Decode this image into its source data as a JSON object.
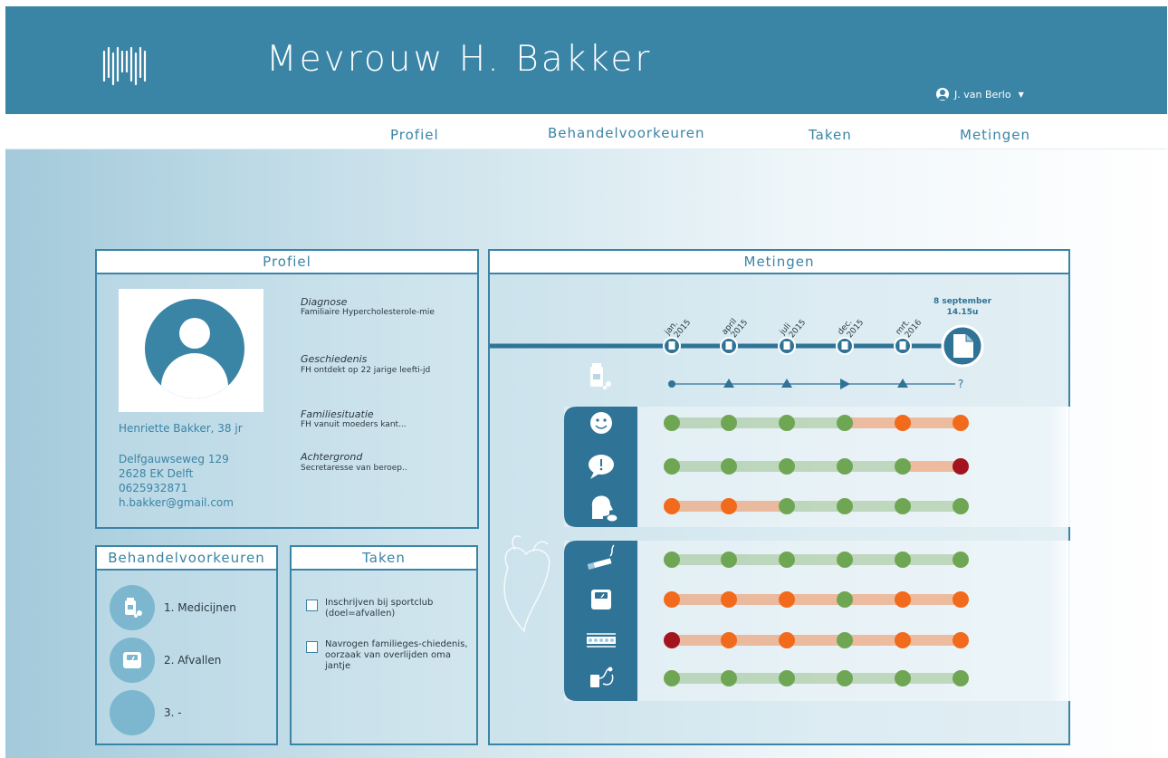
{
  "header": {
    "patient_name": "Mevrouw H. Bakker",
    "user_name": "J. van Berlo",
    "user_caret": "▼",
    "brand_color": "#3a84a6"
  },
  "nav": {
    "tabs": [
      {
        "label": "Profiel"
      },
      {
        "label": "Behandelvoorkeuren"
      },
      {
        "label": "Taken"
      },
      {
        "label": "Metingen"
      }
    ]
  },
  "profiel": {
    "title": "Profiel",
    "name_age": "Henriette Bakker, 38 jr",
    "address_line1": "Delfgauwseweg 129",
    "address_line2": "2628 EK Delft",
    "phone": "0625932871",
    "email": "h.bakker@gmail.com",
    "diagnose_label": "Diagnose",
    "diagnose_value": "Familiaire Hypercholesterole-mie",
    "geschiedenis_label": "Geschiedenis",
    "geschiedenis_value": "FH ontdekt op 22 jarige leefti-jd",
    "familie_label": "Familiesituatie",
    "familie_value": "FH vanuit moeders kant...",
    "achtergrond_label": "Achtergrond",
    "achtergrond_value": "Secretaresse van beroep.."
  },
  "behandelvoorkeuren": {
    "title": "Behandelvoorkeuren",
    "items": [
      {
        "label": "1. Medicijnen",
        "icon": "medication-icon"
      },
      {
        "label": "2. Afvallen",
        "icon": "scale-icon"
      },
      {
        "label": "3. -",
        "icon": "empty-icon"
      }
    ]
  },
  "taken": {
    "title": "Taken",
    "items": [
      {
        "label": "Inschrijven bij sportclub (doel=afvallen)",
        "checked": false
      },
      {
        "label": "Navrogen familieges-chiedenis, oorzaak van overlijden oma jantje",
        "checked": false
      }
    ]
  },
  "metingen": {
    "title": "Metingen",
    "dates": [
      "jan. 2015",
      "april 2015",
      "juli 2015",
      "dec. 2015",
      "mrt. 2016"
    ],
    "current_date": "8 september",
    "current_time": "14.15u",
    "medication_trend": [
      "dot",
      "up",
      "up",
      "right",
      "up",
      "?"
    ],
    "status_colors": {
      "green": "#6fa654",
      "orange": "#f26a1b",
      "red": "#a3141e"
    },
    "groups": [
      {
        "rows": [
          {
            "icon": "mood-icon",
            "statuses": [
              "green",
              "green",
              "green",
              "green",
              "orange",
              "orange"
            ]
          },
          {
            "icon": "alert-icon",
            "statuses": [
              "green",
              "green",
              "green",
              "green",
              "green",
              "red"
            ]
          },
          {
            "icon": "head-icon",
            "statuses": [
              "orange",
              "orange",
              "green",
              "green",
              "green",
              "green"
            ]
          }
        ]
      },
      {
        "rows": [
          {
            "icon": "cigarette-icon",
            "statuses": [
              "green",
              "green",
              "green",
              "green",
              "green",
              "green"
            ]
          },
          {
            "icon": "scale-icon",
            "statuses": [
              "orange",
              "orange",
              "orange",
              "green",
              "orange",
              "orange"
            ]
          },
          {
            "icon": "cholesterol-icon",
            "statuses": [
              "red",
              "orange",
              "orange",
              "green",
              "orange",
              "orange"
            ]
          },
          {
            "icon": "blood-pressure-icon",
            "statuses": [
              "green",
              "green",
              "green",
              "green",
              "green",
              "green"
            ]
          }
        ]
      }
    ]
  }
}
